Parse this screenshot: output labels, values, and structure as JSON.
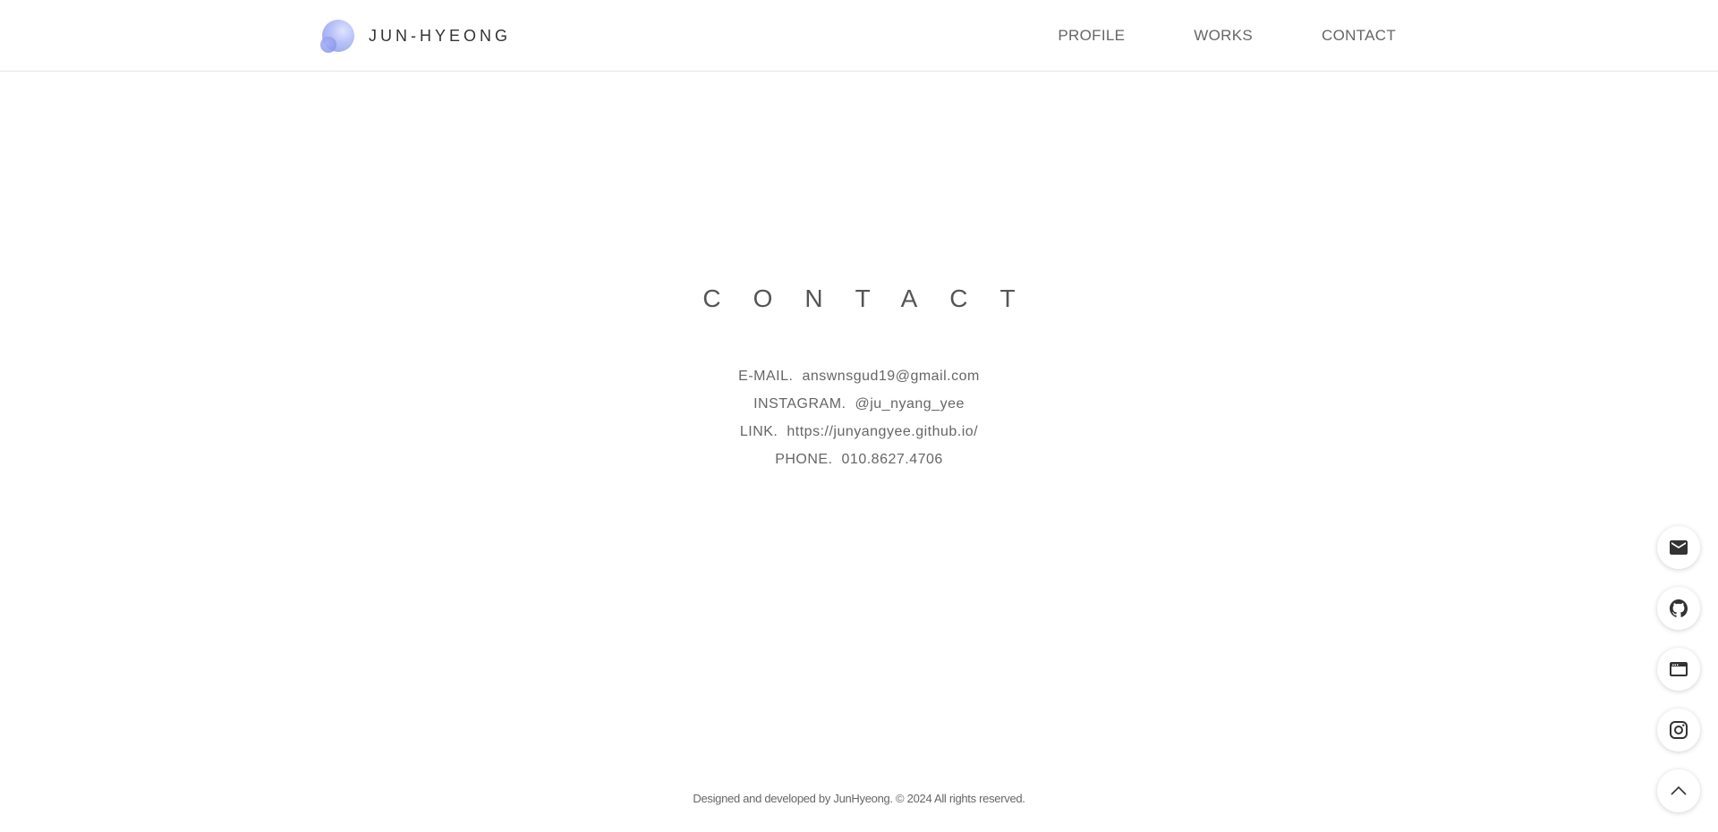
{
  "header": {
    "logo_text": "JUN-HYEONG",
    "nav": [
      "PROFILE",
      "WORKS",
      "CONTACT"
    ]
  },
  "contact": {
    "title": "CONTACT",
    "items": [
      {
        "label": "E-MAIL.",
        "value": "answnsgud19@gmail.com"
      },
      {
        "label": "INSTAGRAM.",
        "value": "@ju_nyang_yee"
      },
      {
        "label": "LINK.",
        "value": "https://junyangyee.github.io/"
      },
      {
        "label": "PHONE.",
        "value": "010.8627.4706"
      }
    ]
  },
  "footer": {
    "text": "Designed and developed by JunHyeong. © 2024 All rights reserved."
  },
  "floating_buttons": [
    "mail-icon",
    "github-icon",
    "browser-icon",
    "instagram-icon",
    "chevron-up-icon"
  ],
  "colors": {
    "text": "#555555",
    "header_border": "#e4e4e4",
    "logo_gradient": [
      "#dfe3ff",
      "#8f9df0"
    ]
  }
}
